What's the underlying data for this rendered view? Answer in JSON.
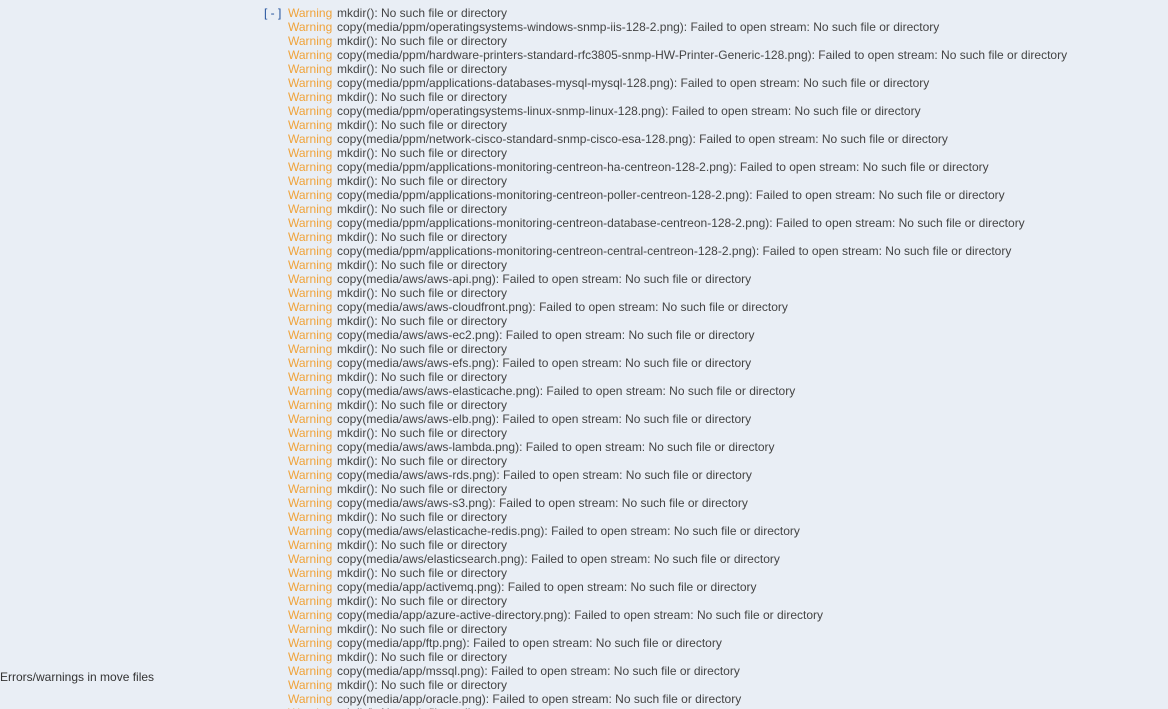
{
  "section_label": "Errors/warnings in move files",
  "toggle_label": "[ - ]",
  "level_label": "Warning",
  "colors": {
    "warning": "#f0a33a",
    "toggle": "#1f4f9a",
    "background": "#e9eef5"
  },
  "messages": [
    "mkdir(): No such file or directory",
    "copy(media/ppm/operatingsystems-windows-snmp-iis-128-2.png): Failed to open stream: No such file or directory",
    "mkdir(): No such file or directory",
    "copy(media/ppm/hardware-printers-standard-rfc3805-snmp-HW-Printer-Generic-128.png): Failed to open stream: No such file or directory",
    "mkdir(): No such file or directory",
    "copy(media/ppm/applications-databases-mysql-mysql-128.png): Failed to open stream: No such file or directory",
    "mkdir(): No such file or directory",
    "copy(media/ppm/operatingsystems-linux-snmp-linux-128.png): Failed to open stream: No such file or directory",
    "mkdir(): No such file or directory",
    "copy(media/ppm/network-cisco-standard-snmp-cisco-esa-128.png): Failed to open stream: No such file or directory",
    "mkdir(): No such file or directory",
    "copy(media/ppm/applications-monitoring-centreon-ha-centreon-128-2.png): Failed to open stream: No such file or directory",
    "mkdir(): No such file or directory",
    "copy(media/ppm/applications-monitoring-centreon-poller-centreon-128-2.png): Failed to open stream: No such file or directory",
    "mkdir(): No such file or directory",
    "copy(media/ppm/applications-monitoring-centreon-database-centreon-128-2.png): Failed to open stream: No such file or directory",
    "mkdir(): No such file or directory",
    "copy(media/ppm/applications-monitoring-centreon-central-centreon-128-2.png): Failed to open stream: No such file or directory",
    "mkdir(): No such file or directory",
    "copy(media/aws/aws-api.png): Failed to open stream: No such file or directory",
    "mkdir(): No such file or directory",
    "copy(media/aws/aws-cloudfront.png): Failed to open stream: No such file or directory",
    "mkdir(): No such file or directory",
    "copy(media/aws/aws-ec2.png): Failed to open stream: No such file or directory",
    "mkdir(): No such file or directory",
    "copy(media/aws/aws-efs.png): Failed to open stream: No such file or directory",
    "mkdir(): No such file or directory",
    "copy(media/aws/aws-elasticache.png): Failed to open stream: No such file or directory",
    "mkdir(): No such file or directory",
    "copy(media/aws/aws-elb.png): Failed to open stream: No such file or directory",
    "mkdir(): No such file or directory",
    "copy(media/aws/aws-lambda.png): Failed to open stream: No such file or directory",
    "mkdir(): No such file or directory",
    "copy(media/aws/aws-rds.png): Failed to open stream: No such file or directory",
    "mkdir(): No such file or directory",
    "copy(media/aws/aws-s3.png): Failed to open stream: No such file or directory",
    "mkdir(): No such file or directory",
    "copy(media/aws/elasticache-redis.png): Failed to open stream: No such file or directory",
    "mkdir(): No such file or directory",
    "copy(media/aws/elasticsearch.png): Failed to open stream: No such file or directory",
    "mkdir(): No such file or directory",
    "copy(media/app/activemq.png): Failed to open stream: No such file or directory",
    "mkdir(): No such file or directory",
    "copy(media/app/azure-active-directory.png): Failed to open stream: No such file or directory",
    "mkdir(): No such file or directory",
    "copy(media/app/ftp.png): Failed to open stream: No such file or directory",
    "mkdir(): No such file or directory",
    "copy(media/app/mssql.png): Failed to open stream: No such file or directory",
    "mkdir(): No such file or directory",
    "copy(media/app/oracle.png): Failed to open stream: No such file or directory",
    "mkdir(): No such file or directory"
  ]
}
